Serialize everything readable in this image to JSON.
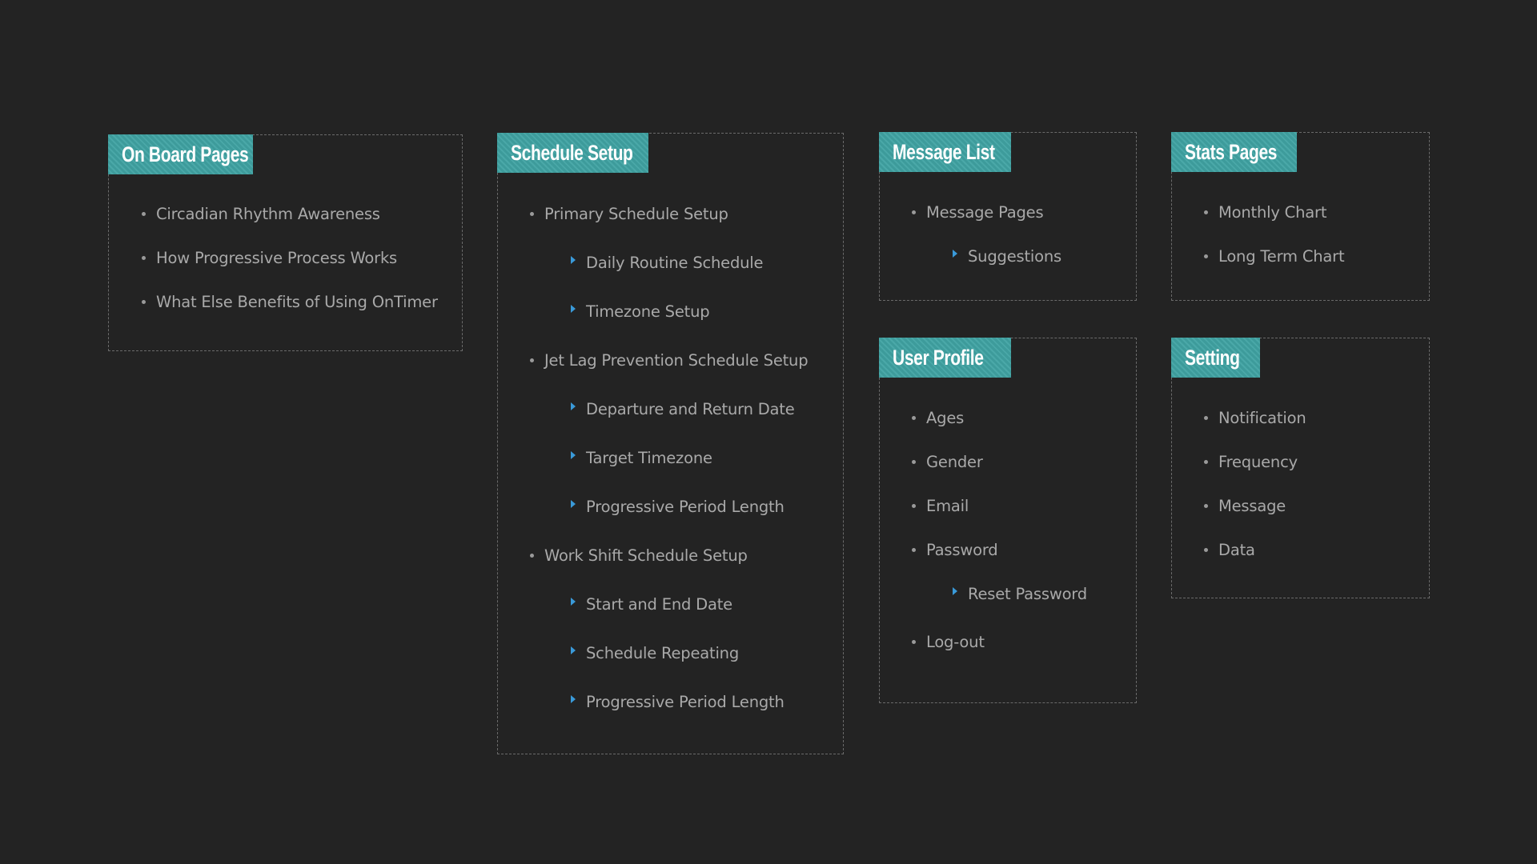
{
  "sections": {
    "onboard": {
      "title": "On Board Pages",
      "items": [
        {
          "label": "Circadian Rhythm Awareness",
          "level": 1
        },
        {
          "label": "How Progressive Process Works",
          "level": 1
        },
        {
          "label": "What Else Benefits of Using OnTimer",
          "level": 1
        }
      ]
    },
    "schedule": {
      "title": "Schedule Setup",
      "items": [
        {
          "label": "Primary Schedule Setup",
          "level": 1
        },
        {
          "label": "Daily Routine Schedule",
          "level": 2
        },
        {
          "label": "Timezone Setup",
          "level": 2
        },
        {
          "label": "Jet Lag Prevention Schedule Setup",
          "level": 1
        },
        {
          "label": "Departure and Return Date",
          "level": 2
        },
        {
          "label": "Target Timezone",
          "level": 2
        },
        {
          "label": "Progressive Period Length",
          "level": 2
        },
        {
          "label": "Work Shift Schedule Setup",
          "level": 1
        },
        {
          "label": "Start and End Date",
          "level": 2
        },
        {
          "label": "Schedule Repeating",
          "level": 2
        },
        {
          "label": "Progressive Period Length",
          "level": 2
        }
      ]
    },
    "message": {
      "title": "Message List",
      "items": [
        {
          "label": "Message Pages",
          "level": 1
        },
        {
          "label": "Suggestions",
          "level": 2
        }
      ]
    },
    "stats": {
      "title": "Stats Pages",
      "items": [
        {
          "label": "Monthly Chart",
          "level": 1
        },
        {
          "label": "Long Term Chart",
          "level": 1
        }
      ]
    },
    "profile": {
      "title": "User Profile",
      "items": [
        {
          "label": "Ages",
          "level": 1
        },
        {
          "label": "Gender",
          "level": 1
        },
        {
          "label": "Email",
          "level": 1
        },
        {
          "label": "Password",
          "level": 1
        },
        {
          "label": "Reset Password",
          "level": 2
        },
        {
          "label": "Log-out",
          "level": 1
        }
      ]
    },
    "setting": {
      "title": "Setting",
      "items": [
        {
          "label": "Notification",
          "level": 1
        },
        {
          "label": "Frequency",
          "level": 1
        },
        {
          "label": "Message",
          "level": 1
        },
        {
          "label": "Data",
          "level": 1
        }
      ]
    }
  },
  "colors": {
    "background": "#232323",
    "header": "#3d9b9b",
    "header_stripe": "#4aa8a8",
    "text": "#a9a9a9",
    "sub_arrow": "#3a9ad9"
  }
}
